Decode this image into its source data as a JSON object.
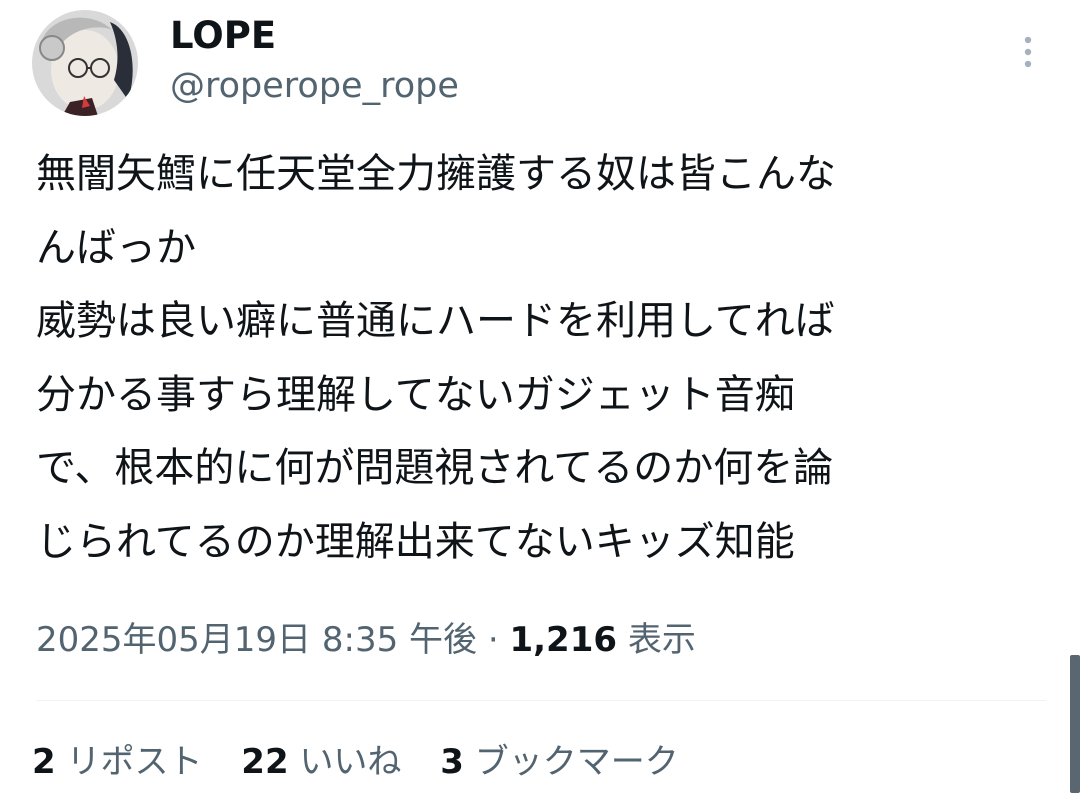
{
  "author": {
    "display_name": "LOPE",
    "handle": "@roperope_rope"
  },
  "tweet": {
    "lines": [
      "無闇矢鱈に任天堂全力擁護する奴は皆こんな",
      "んばっか",
      "威勢は良い癖に普通にハードを利用してれば",
      "分かる事すら理解してないガジェット音痴",
      "で、根本的に何が問題視されてるのか何を論",
      "じられてるのか理解出来てないキッズ知能"
    ]
  },
  "meta": {
    "timestamp": "2025年05月19日 8:35 午後",
    "separator": "·",
    "views_count": "1,216",
    "views_label": "表示"
  },
  "stats": {
    "reposts": {
      "count": "2",
      "label": "リポスト"
    },
    "likes": {
      "count": "22",
      "label": "いいね"
    },
    "bookmarks": {
      "count": "3",
      "label": "ブックマーク"
    }
  },
  "icons": {
    "more": "more-vertical-icon"
  },
  "colors": {
    "text_primary": "#0f1419",
    "text_secondary": "#536471",
    "divider": "#eff3f4"
  }
}
